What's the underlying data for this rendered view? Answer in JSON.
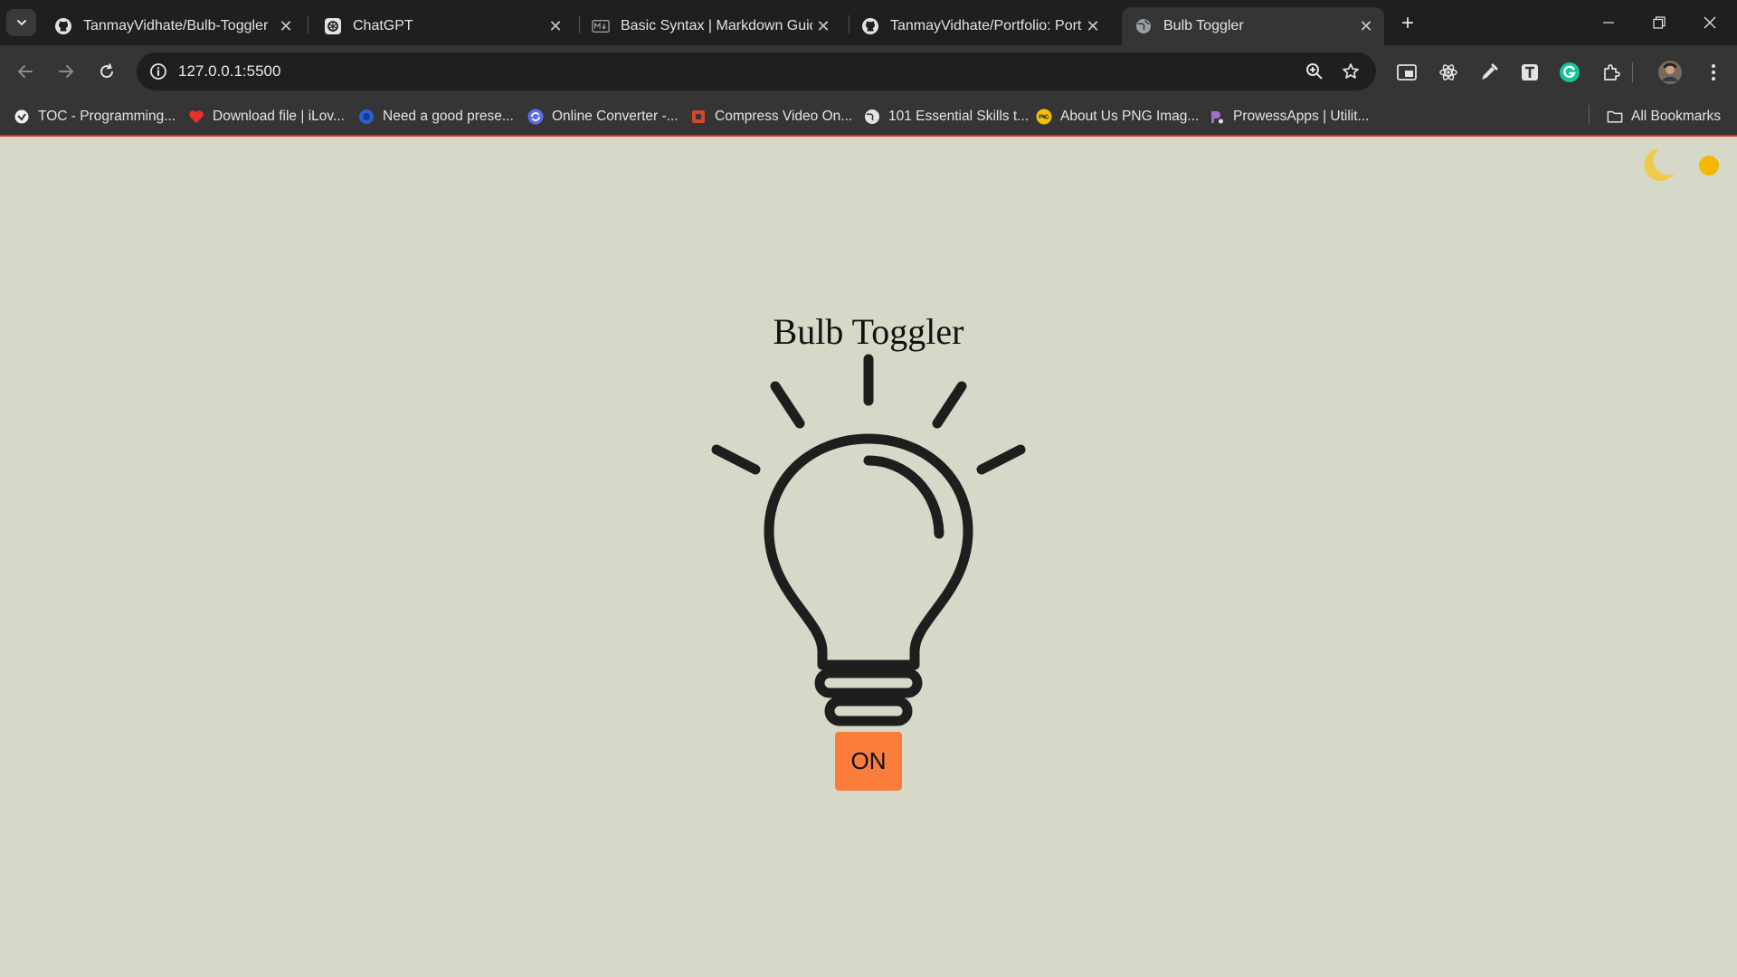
{
  "browser": {
    "tabs": [
      {
        "title": "TanmayVidhate/Bulb-Toggler",
        "icon": "github-icon"
      },
      {
        "title": "ChatGPT",
        "icon": "chatgpt-icon"
      },
      {
        "title": "Basic Syntax | Markdown Guide",
        "icon": "markdown-icon"
      },
      {
        "title": "TanmayVidhate/Portfolio: Portfo",
        "icon": "github-icon"
      },
      {
        "title": "Bulb Toggler",
        "icon": "globe-icon",
        "active": true
      }
    ],
    "new_tab_label": "+",
    "close_glyph": "✕",
    "address": "127.0.0.1:5500",
    "bookmarks": [
      {
        "label": "TOC - Programming...",
        "icon": "bookmark-toc-icon"
      },
      {
        "label": "Download file | iLov...",
        "icon": "heart-icon"
      },
      {
        "label": "Need a good prese...",
        "icon": "blue-circle-icon"
      },
      {
        "label": "Online Converter -...",
        "icon": "converter-icon"
      },
      {
        "label": "Compress Video On...",
        "icon": "video-compress-icon"
      },
      {
        "label": "101 Essential Skills t...",
        "icon": "globe-icon"
      },
      {
        "label": "About Us PNG Imag...",
        "icon": "png-icon"
      },
      {
        "label": "ProwessApps | Utilit...",
        "icon": "prowess-icon"
      }
    ],
    "all_bookmarks_label": "All Bookmarks",
    "colors": {
      "tabstrip": "#1f1f1f",
      "toolbar": "#353535",
      "accent_line": "#d93025"
    }
  },
  "page": {
    "title": "Bulb Toggler",
    "toggle_label": "ON",
    "colors": {
      "background": "#d6d9c7",
      "button": "#fb7d3c",
      "bulb_stroke": "#1e1e1e",
      "moon": "#f2c94c",
      "sun": "#f5b700"
    },
    "theme_icons": [
      "moon-icon",
      "sun-icon"
    ]
  }
}
